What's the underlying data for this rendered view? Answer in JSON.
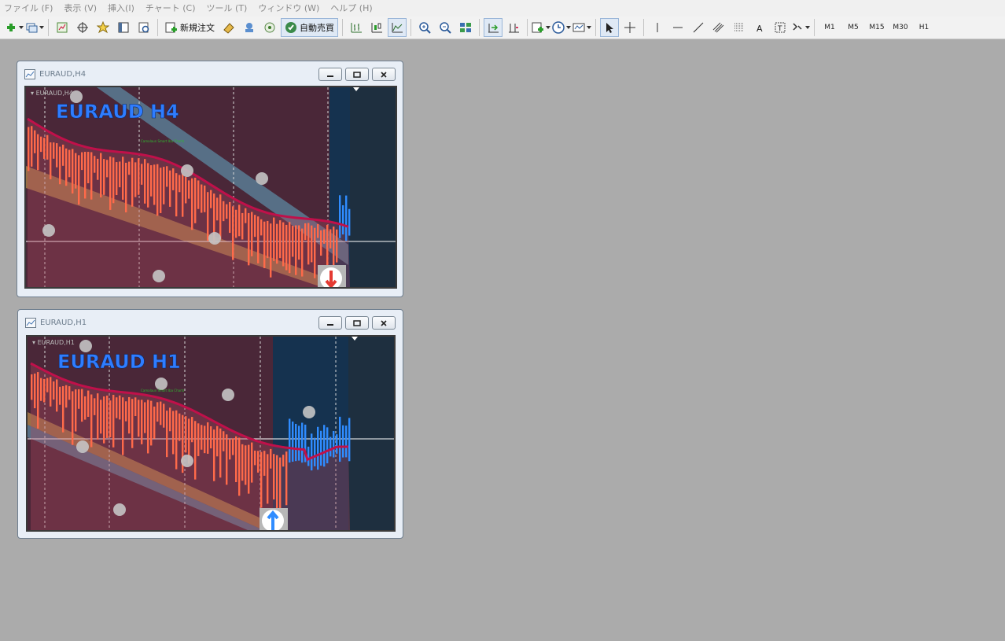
{
  "menu": [
    "ファイル (F)",
    "表示 (V)",
    "挿入(I)",
    "チャート (C)",
    "ツール (T)",
    "ウィンドウ (W)",
    "ヘルプ (H)"
  ],
  "toolbar": {
    "new_order_label": "新規注文",
    "auto_trade_label": "自動売買",
    "timeframes": [
      "M1",
      "M5",
      "M15",
      "M30",
      "H1"
    ]
  },
  "windows": [
    {
      "title": "EURAUD,H4",
      "chart_label": "EURAUD,H4",
      "overlay_title": "EURAUD H4",
      "watermark": "Camalaun Smart Iba Charts"
    },
    {
      "title": "EURAUD,H1",
      "chart_label": "EURAUD,H1",
      "overlay_title": "EURAUD H1",
      "watermark": "Camalaun Smart Iba Charts"
    }
  ],
  "colors": {
    "chart_bg": "#4a2738",
    "chart_bg_right": "#1e2f3f",
    "bear_candle": "#ff6a4a",
    "bull_candle": "#2f8cff",
    "overlay_title": "#2f7dff",
    "ma_line": "#b01040"
  },
  "icons": [
    "new-chart-icon",
    "profiles-icon",
    "market-watch-icon",
    "crosshair-icon",
    "navigator-icon",
    "terminal-icon",
    "tester-icon",
    "new-order-icon",
    "metaeditor-icon",
    "signals-icon",
    "radio-icon",
    "auto-trade-icon",
    "bar-chart-icon",
    "candle-chart-icon",
    "line-chart-icon",
    "zoom-in-icon",
    "zoom-out-icon",
    "tile-icon",
    "autoscroll-icon",
    "chart-shift-icon",
    "indicators-icon",
    "period-icon",
    "templates-icon",
    "cursor-icon",
    "cross-icon",
    "vertical-line-icon",
    "horizontal-line-icon",
    "trend-line-icon",
    "equidistant-channel-icon",
    "fibonacci-icon",
    "text-icon",
    "label-icon",
    "arrows-icon"
  ]
}
